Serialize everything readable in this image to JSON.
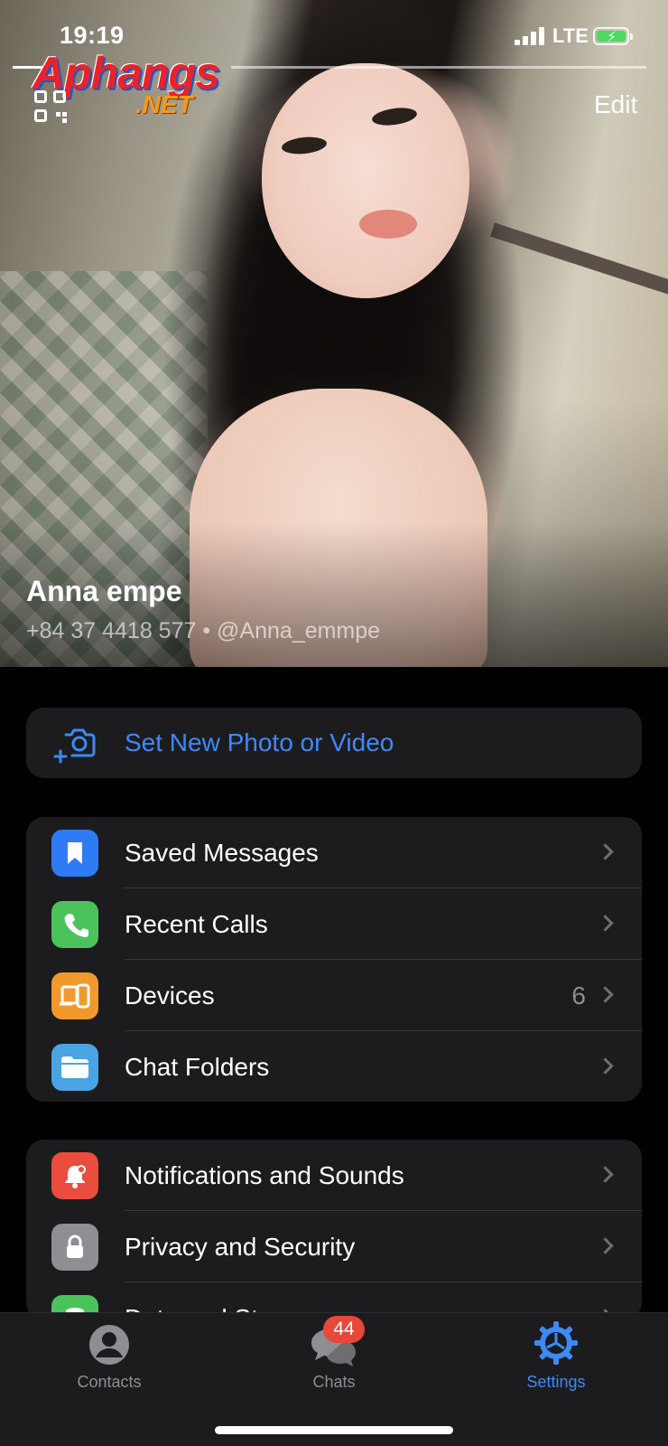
{
  "status_bar": {
    "time": "19:19",
    "network": "LTE",
    "battery_charging": true
  },
  "watermark": {
    "brand": "Aphangs",
    "tld": ".NET"
  },
  "header": {
    "edit_label": "Edit",
    "qr_icon": "qr-code-icon"
  },
  "profile": {
    "name": "Anna empe",
    "subline": "+84 37 4418 577 • @Anna_emmpe"
  },
  "photo_action": {
    "label": "Set New Photo or Video",
    "icon": "add-photo-icon",
    "color": "#3d8af7"
  },
  "group_main": [
    {
      "label": "Saved Messages",
      "icon": "bookmark-icon",
      "color": "#2f7bf5",
      "value": ""
    },
    {
      "label": "Recent Calls",
      "icon": "phone-icon",
      "color": "#4cc25b",
      "value": ""
    },
    {
      "label": "Devices",
      "icon": "devices-icon",
      "color": "#f2992e",
      "value": "6"
    },
    {
      "label": "Chat Folders",
      "icon": "folder-icon",
      "color": "#4aa3e3",
      "value": ""
    }
  ],
  "group_settings": [
    {
      "label": "Notifications and Sounds",
      "icon": "bell-icon",
      "color": "#ea4d3d"
    },
    {
      "label": "Privacy and Security",
      "icon": "lock-icon",
      "color": "#8e8e93"
    },
    {
      "label": "Data and Storage",
      "icon": "database-icon",
      "color": "#4cc25b"
    }
  ],
  "tabbar": {
    "tabs": [
      {
        "label": "Contacts",
        "icon": "person-icon",
        "active": false
      },
      {
        "label": "Chats",
        "icon": "chats-icon",
        "active": false,
        "badge": "44"
      },
      {
        "label": "Settings",
        "icon": "gear-icon",
        "active": true
      }
    ],
    "active_color": "#3d8af7",
    "inactive_color": "#8e8e93"
  }
}
